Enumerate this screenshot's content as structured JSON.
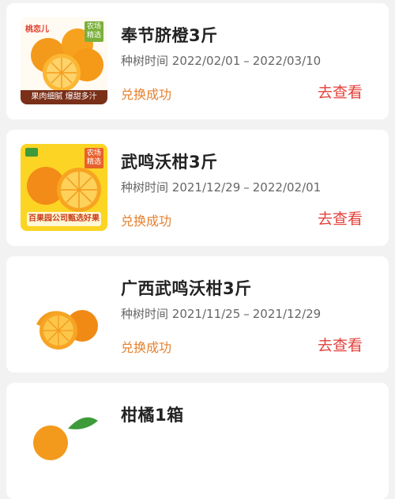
{
  "orders": [
    {
      "title": "奉节脐橙3斤",
      "period_label": "种树时间",
      "period_start": "2022/02/01",
      "period_end": "2022/03/10",
      "status": "兑换成功",
      "view_label": "去查看",
      "thumb": {
        "brand": "桃恋儿",
        "badge": "农场精选",
        "banner": "果肉细腻 爆甜多汁"
      }
    },
    {
      "title": "武鸣沃柑3斤",
      "period_label": "种树时间",
      "period_start": "2021/12/29",
      "period_end": "2022/02/01",
      "status": "兑换成功",
      "view_label": "去查看",
      "thumb": {
        "badge": "农场精选",
        "banner": "百果园公司甄选好果"
      }
    },
    {
      "title": "广西武鸣沃柑3斤",
      "period_label": "种树时间",
      "period_start": "2021/11/25",
      "period_end": "2021/12/29",
      "status": "兑换成功",
      "view_label": "去查看"
    },
    {
      "title": "柑橘1箱"
    }
  ],
  "separator": "–",
  "colors": {
    "background": "#f2f2f2",
    "status": "#e6802d",
    "view_link": "#e4413b",
    "title": "#222222",
    "period": "#666666"
  }
}
